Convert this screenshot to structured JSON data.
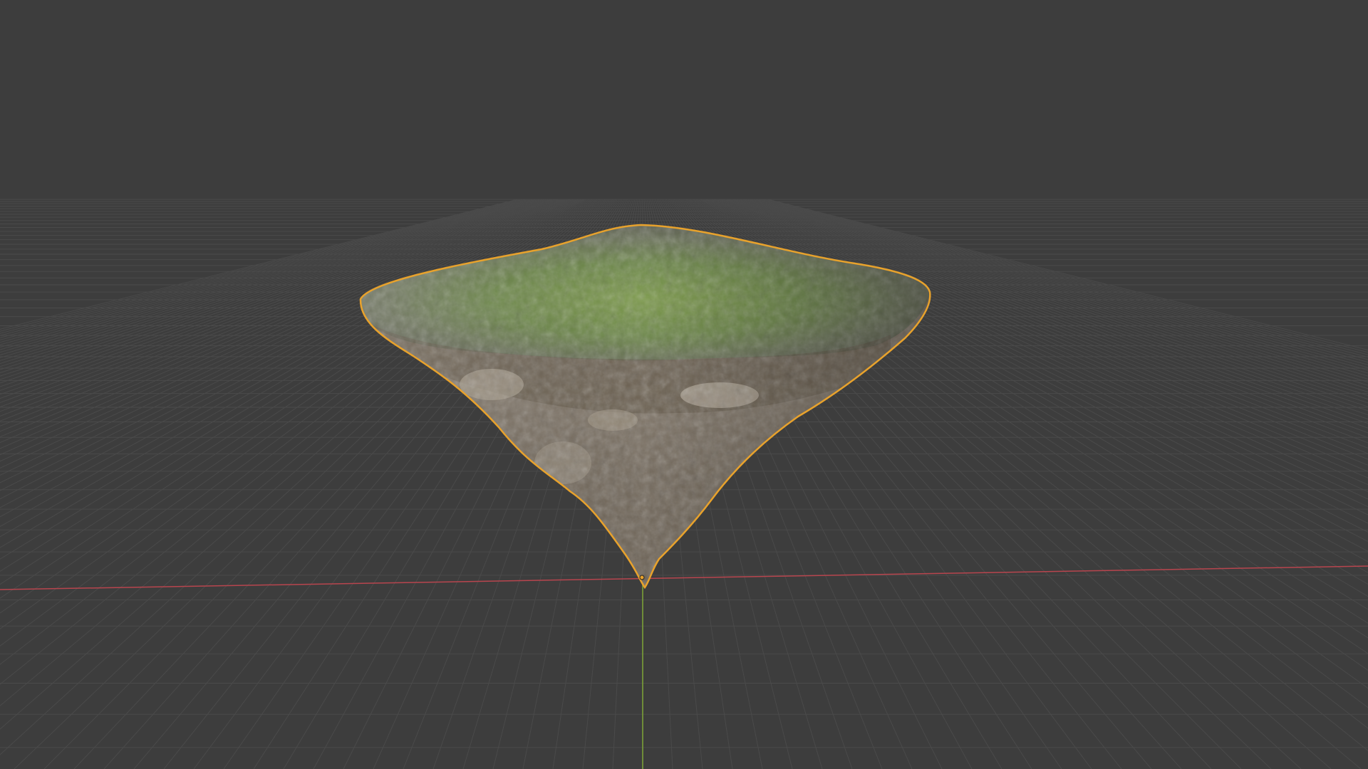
{
  "viewport": {
    "mode": "3d-viewport",
    "background_color": "#3d3d3d",
    "grid": true,
    "grid_line_color": "#4a4a4a",
    "x_axis_color": "#b8454e",
    "y_axis_color": "#7fa636",
    "selected_object": {
      "name": "",
      "type": "mesh",
      "description_icon": "floating-island-rock-icon",
      "outline_color": "#e8a22c",
      "top_surface_color": "#6f8a4c",
      "side_color": "#7a6e60",
      "origin_marker": "origin-point-icon"
    }
  }
}
